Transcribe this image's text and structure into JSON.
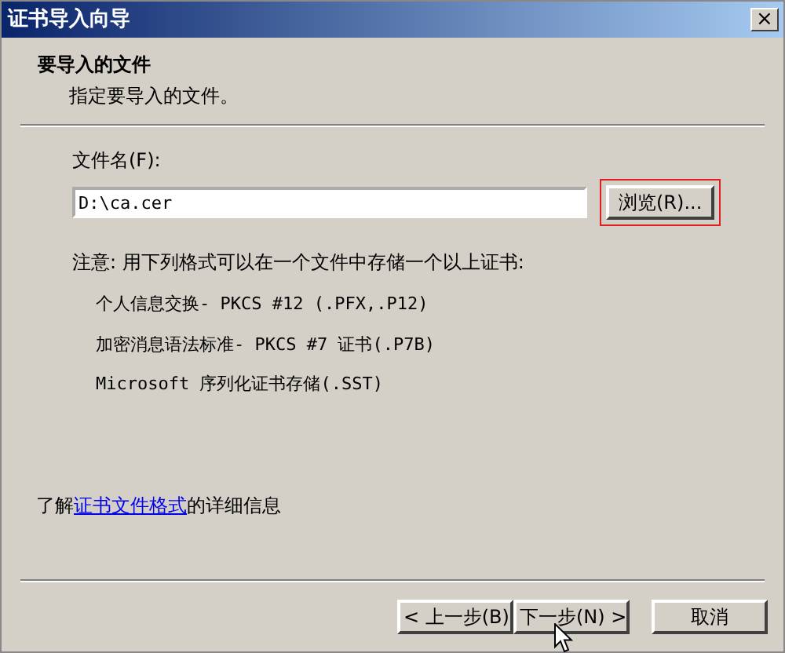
{
  "window": {
    "title": "证书导入向导",
    "close": "×"
  },
  "header": {
    "title": "要导入的文件",
    "subtitle": "指定要导入的文件。"
  },
  "file_field": {
    "label": "文件名(F):",
    "value": "D:\\ca.cer"
  },
  "browse_button": {
    "label": "浏览(R)...",
    "highlighted": true
  },
  "note": "注意: 用下列格式可以在一个文件中存储一个以上证书:",
  "formats": [
    "个人信息交换- PKCS #12 (.PFX,.P12)",
    "加密消息语法标准- PKCS #7 证书(.P7B)",
    "Microsoft 序列化证书存储(.SST)"
  ],
  "more_info": {
    "before": "了解",
    "link": "证书文件格式",
    "after": "的详细信息"
  },
  "buttons": [
    {
      "label": "< 上一步(B)",
      "kind": "back"
    },
    {
      "label": "下一步(N) >",
      "kind": "next"
    },
    {
      "label": "取消",
      "kind": "cancel"
    }
  ]
}
